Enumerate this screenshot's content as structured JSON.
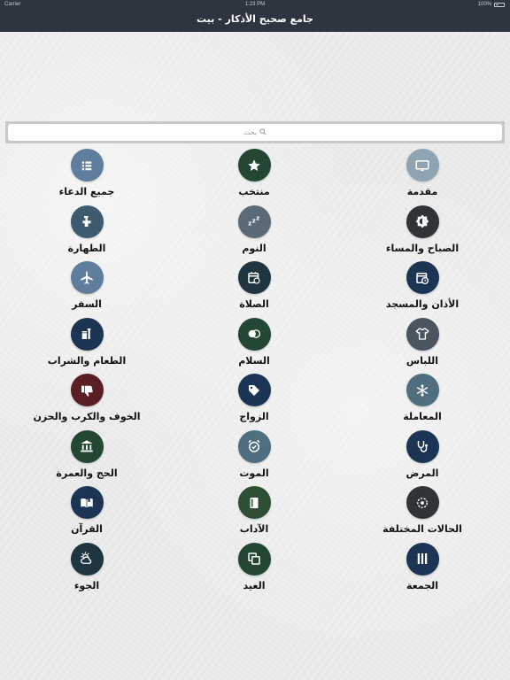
{
  "status_bar": {
    "carrier": "Carrier",
    "time": "1:23 PM",
    "battery": "100%"
  },
  "nav": {
    "title": "جامع صحيح الأذكار - بيت"
  },
  "search": {
    "placeholder": "بحث"
  },
  "colors": {
    "topbar": "#2e3540",
    "slate_blue": "#5f7d9c",
    "dark_green": "#234733",
    "gray": "#5a6a77",
    "charcoal": "#303438",
    "teal_blue": "#3d5a6e",
    "navy": "#1d3555",
    "maroon": "#5a1f25",
    "steel": "#4f6f80"
  },
  "menu": [
    {
      "label": "مقدمة",
      "icon": "screen-icon",
      "color": "#8fa4b3"
    },
    {
      "label": "منتخب",
      "icon": "star-icon",
      "color": "#234733"
    },
    {
      "label": "جميع الدعاء",
      "icon": "list-icon",
      "color": "#5f7d9c"
    },
    {
      "label": "الصباح والمساء",
      "icon": "brightness-icon",
      "color": "#303438"
    },
    {
      "label": "النوم",
      "icon": "zzz-icon",
      "color": "#5a6a77"
    },
    {
      "label": "الطهارة",
      "icon": "faucet-icon",
      "color": "#3d5a6e"
    },
    {
      "label": "الأذان والمسجد",
      "icon": "calendar-clock-icon",
      "color": "#1d3555"
    },
    {
      "label": "الصلاة",
      "icon": "calendar-icon",
      "color": "#1f3540"
    },
    {
      "label": "السفر",
      "icon": "airplane-icon",
      "color": "#5f7d9c"
    },
    {
      "label": "اللباس",
      "icon": "shirt-icon",
      "color": "#4a5560"
    },
    {
      "label": "السلام",
      "icon": "toggle-icon",
      "color": "#234733"
    },
    {
      "label": "الطعام والشراب",
      "icon": "food-icon",
      "color": "#1d3555"
    },
    {
      "label": "المعاملة",
      "icon": "snowflake-icon",
      "color": "#4f6f80"
    },
    {
      "label": "الزواج",
      "icon": "tag-icon",
      "color": "#1d3555"
    },
    {
      "label": "الخوف والكرب والحزن",
      "icon": "thumbs-down-icon",
      "color": "#5a1f25"
    },
    {
      "label": "المرض",
      "icon": "stethoscope-icon",
      "color": "#1d3555"
    },
    {
      "label": "الموت",
      "icon": "alarm-icon",
      "color": "#4f6f80"
    },
    {
      "label": "الحج والعمرة",
      "icon": "bank-icon",
      "color": "#234733"
    },
    {
      "label": "الحالات المختلفة",
      "icon": "target-icon",
      "color": "#303438"
    },
    {
      "label": "الآداب",
      "icon": "book-icon",
      "color": "#2e4f33"
    },
    {
      "label": "القرآن",
      "icon": "open-book-icon",
      "color": "#1d3555"
    },
    {
      "label": "الجمعة",
      "icon": "columns-icon",
      "color": "#1d3555"
    },
    {
      "label": "العيد",
      "icon": "layers-icon",
      "color": "#234733"
    },
    {
      "label": "الجوء",
      "icon": "weather-icon",
      "color": "#1f3540"
    }
  ]
}
